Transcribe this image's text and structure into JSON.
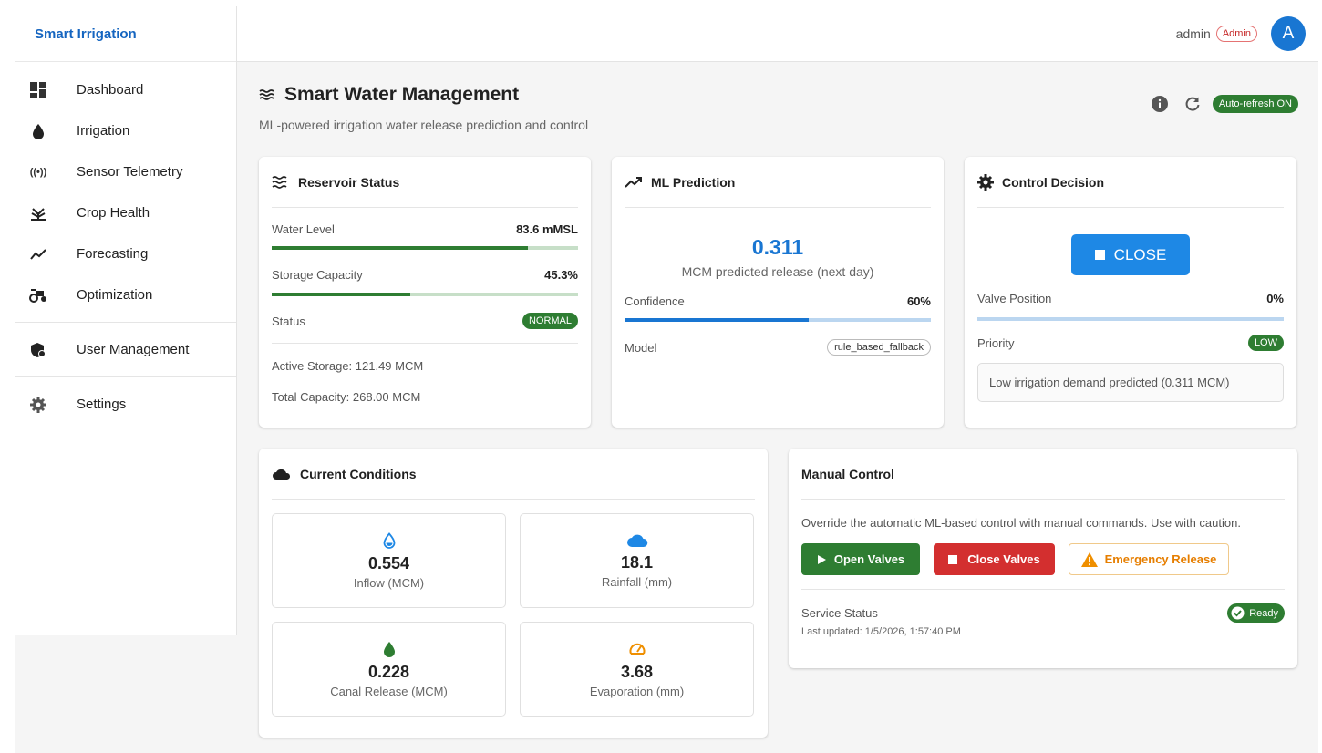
{
  "app": {
    "brand": "Smart Irrigation"
  },
  "sidebar": {
    "items": [
      {
        "label": "Dashboard",
        "icon": "dashboard-icon"
      },
      {
        "label": "Irrigation",
        "icon": "water-drop-icon"
      },
      {
        "label": "Sensor Telemetry",
        "icon": "sensor-signal-icon"
      },
      {
        "label": "Crop Health",
        "icon": "crop-icon"
      },
      {
        "label": "Forecasting",
        "icon": "trend-icon"
      },
      {
        "label": "Optimization",
        "icon": "tractor-icon"
      },
      {
        "label": "User Management",
        "icon": "admin-shield-icon"
      },
      {
        "label": "Settings",
        "icon": "gear-icon"
      }
    ]
  },
  "topbar": {
    "username": "admin",
    "role": "Admin",
    "avatar_letter": "A"
  },
  "header": {
    "title": "Smart Water Management",
    "subtitle": "ML-powered irrigation water release prediction and control",
    "auto_refresh": "Auto-refresh ON"
  },
  "reservoir": {
    "title": "Reservoir Status",
    "water_level_label": "Water Level",
    "water_level_value": "83.6 mMSL",
    "water_level_fraction": 0.836,
    "storage_label": "Storage Capacity",
    "storage_value": "45.3%",
    "storage_fraction": 0.453,
    "status_label": "Status",
    "status_value": "NORMAL",
    "active_storage": "Active Storage: 121.49 MCM",
    "total_capacity": "Total Capacity: 268.00 MCM"
  },
  "prediction": {
    "title": "ML Prediction",
    "value": "0.311",
    "caption": "MCM predicted release (next day)",
    "confidence_label": "Confidence",
    "confidence_value": "60%",
    "confidence_fraction": 0.6,
    "model_label": "Model",
    "model_value": "rule_based_fallback"
  },
  "control": {
    "title": "Control Decision",
    "decision": "CLOSE",
    "valve_label": "Valve Position",
    "valve_value": "0%",
    "valve_fraction": 0,
    "priority_label": "Priority",
    "priority_value": "LOW",
    "message": "Low irrigation demand predicted (0.311 MCM)"
  },
  "conditions": {
    "title": "Current Conditions",
    "items": [
      {
        "value": "0.554",
        "label": "Inflow (MCM)",
        "icon": "water-drop-outline-icon",
        "color": "#1e88e5"
      },
      {
        "value": "18.1",
        "label": "Rainfall (mm)",
        "icon": "cloud-icon",
        "color": "#1e88e5"
      },
      {
        "value": "0.228",
        "label": "Canal Release (MCM)",
        "icon": "drop-green-icon",
        "color": "#2e7d32"
      },
      {
        "value": "3.68",
        "label": "Evaporation (mm)",
        "icon": "gauge-icon",
        "color": "#ef8f00"
      }
    ]
  },
  "manual": {
    "title": "Manual Control",
    "description": "Override the automatic ML-based control with manual commands. Use with caution.",
    "open_label": "Open Valves",
    "close_label": "Close Valves",
    "emergency_label": "Emergency Release",
    "service_label": "Service Status",
    "service_value": "Ready",
    "last_updated": "Last updated: 1/5/2026, 1:57:40 PM"
  },
  "colors": {
    "accent": "#1976d2",
    "success": "#2e7d32",
    "danger": "#d32f2f",
    "warning": "#e67e00"
  }
}
